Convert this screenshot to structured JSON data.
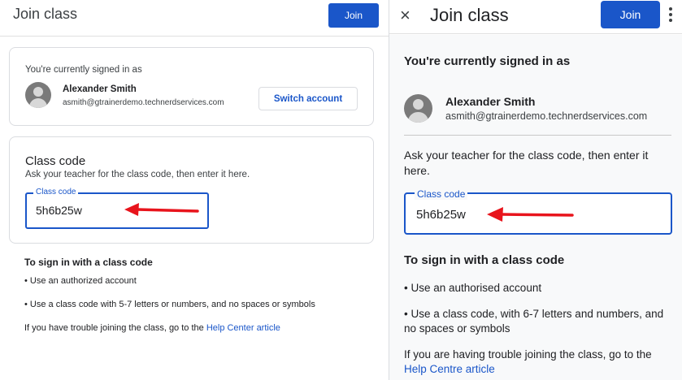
{
  "left": {
    "title": "Join class",
    "join_label": "Join",
    "signed_in_label": "You're currently signed in as",
    "user_name": "Alexander Smith",
    "user_email": "asmith@gtrainerdemo.technerdservices.com",
    "switch_account_label": "Switch account",
    "class_code_title": "Class code",
    "class_code_desc": "Ask your teacher for the class code, then enter it here.",
    "field_label": "Class code",
    "field_value": "5h6b25w",
    "info_title": "To sign in with a class code",
    "bullet1": "• Use an authorized account",
    "bullet2": "• Use a class code with 5-7 letters or numbers, and no spaces or symbols",
    "trouble_text": "If you have trouble joining the class, go to the ",
    "help_link": "Help Center article"
  },
  "right": {
    "close_icon": "×",
    "title": "Join class",
    "join_label": "Join",
    "signed_in_label": "You're currently signed in as",
    "user_name": "Alexander Smith",
    "user_email": "asmith@gtrainerdemo.technerdservices.com",
    "desc": "Ask your teacher for the class code, then enter it here.",
    "field_label": "Class code",
    "field_value": "5h6b25w",
    "info_title": "To sign in with a class code",
    "bullet1": "• Use an authorised account",
    "bullet2": "• Use a class code, with 6-7 letters and numbers, and no spaces or symbols",
    "trouble_text": "If you are having trouble joining the class, go to the ",
    "help_link": "Help Centre article"
  },
  "colors": {
    "accent": "#1a56c9",
    "arrow": "#e8141c"
  },
  "icons": {
    "close": "close-icon",
    "menu": "more-vert-icon",
    "avatar": "avatar-icon",
    "arrow": "red-arrow-annotation"
  }
}
